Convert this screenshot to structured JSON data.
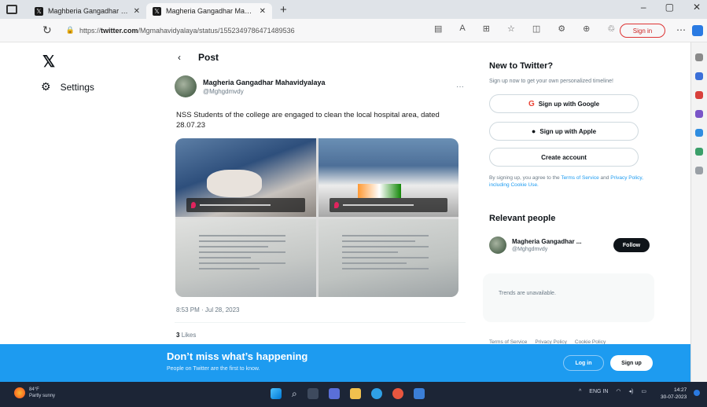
{
  "browser": {
    "tabs": [
      {
        "label": "Maghberia Gangadhar Mahavidyalaya",
        "active": false
      },
      {
        "label": "Magheria Gangadhar Mahavidya",
        "active": true
      }
    ],
    "url_prefix": "https://",
    "url_domain": "twitter.com",
    "url_path": "/Mgmahavidyalaya/status/1552349786471489536",
    "sign_in": "Sign in"
  },
  "left_nav": {
    "logo": "𝕏",
    "settings_label": "Settings"
  },
  "post": {
    "header_title": "Post",
    "author_name": "Magheria Gangadhar Mahavidyalaya",
    "author_handle": "@Mghgdmvdy",
    "text": "NSS Students of the college are engaged to clean the local hospital area, dated 28.07.23",
    "timestamp": "8:53 PM · Jul 28, 2023",
    "likes_count": "3",
    "likes_label": "Likes"
  },
  "sidebar": {
    "new_title": "New to Twitter?",
    "new_sub": "Sign up now to get your own personalized timeline!",
    "google_btn": "Sign up with Google",
    "apple_btn": "Sign up with Apple",
    "create_btn": "Create account",
    "terms_prefix": "By signing up, you agree to the ",
    "terms_link1": "Terms of Service",
    "terms_mid": " and ",
    "terms_link2": "Privacy Policy, including Cookie Use.",
    "relevant_title": "Relevant people",
    "person_name": "Magheria Gangadhar ...",
    "person_handle": "@Mghgdmvdy",
    "follow_btn": "Follow",
    "trends_text": "Trends are unavailable.",
    "footer": [
      "Terms of Service",
      "Privacy Policy",
      "Cookie Policy"
    ]
  },
  "banner": {
    "title": "Don’t miss what’s happening",
    "subtitle": "People on Twitter are the first to know.",
    "login_btn": "Log in",
    "signup_btn": "Sign up"
  },
  "taskbar": {
    "weather_temp": "84°F",
    "weather_desc": "Partly sunny",
    "tray_lang": "ENG",
    "tray_region": "IN",
    "time": "14:27",
    "date": "30-07-2023"
  }
}
